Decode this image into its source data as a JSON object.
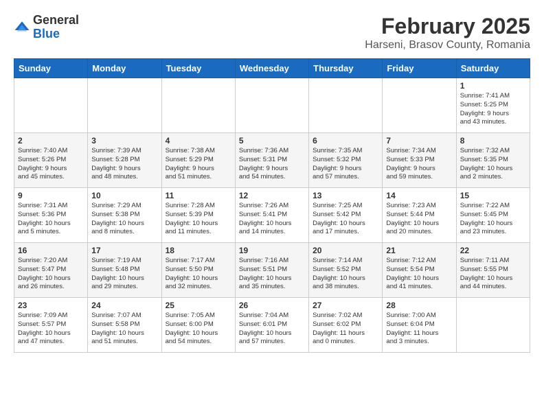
{
  "logo": {
    "general": "General",
    "blue": "Blue"
  },
  "title": "February 2025",
  "location": "Harseni, Brasov County, Romania",
  "weekdays": [
    "Sunday",
    "Monday",
    "Tuesday",
    "Wednesday",
    "Thursday",
    "Friday",
    "Saturday"
  ],
  "weeks": [
    [
      {
        "day": "",
        "info": ""
      },
      {
        "day": "",
        "info": ""
      },
      {
        "day": "",
        "info": ""
      },
      {
        "day": "",
        "info": ""
      },
      {
        "day": "",
        "info": ""
      },
      {
        "day": "",
        "info": ""
      },
      {
        "day": "1",
        "info": "Sunrise: 7:41 AM\nSunset: 5:25 PM\nDaylight: 9 hours\nand 43 minutes."
      }
    ],
    [
      {
        "day": "2",
        "info": "Sunrise: 7:40 AM\nSunset: 5:26 PM\nDaylight: 9 hours\nand 45 minutes."
      },
      {
        "day": "3",
        "info": "Sunrise: 7:39 AM\nSunset: 5:28 PM\nDaylight: 9 hours\nand 48 minutes."
      },
      {
        "day": "4",
        "info": "Sunrise: 7:38 AM\nSunset: 5:29 PM\nDaylight: 9 hours\nand 51 minutes."
      },
      {
        "day": "5",
        "info": "Sunrise: 7:36 AM\nSunset: 5:31 PM\nDaylight: 9 hours\nand 54 minutes."
      },
      {
        "day": "6",
        "info": "Sunrise: 7:35 AM\nSunset: 5:32 PM\nDaylight: 9 hours\nand 57 minutes."
      },
      {
        "day": "7",
        "info": "Sunrise: 7:34 AM\nSunset: 5:33 PM\nDaylight: 9 hours\nand 59 minutes."
      },
      {
        "day": "8",
        "info": "Sunrise: 7:32 AM\nSunset: 5:35 PM\nDaylight: 10 hours\nand 2 minutes."
      }
    ],
    [
      {
        "day": "9",
        "info": "Sunrise: 7:31 AM\nSunset: 5:36 PM\nDaylight: 10 hours\nand 5 minutes."
      },
      {
        "day": "10",
        "info": "Sunrise: 7:29 AM\nSunset: 5:38 PM\nDaylight: 10 hours\nand 8 minutes."
      },
      {
        "day": "11",
        "info": "Sunrise: 7:28 AM\nSunset: 5:39 PM\nDaylight: 10 hours\nand 11 minutes."
      },
      {
        "day": "12",
        "info": "Sunrise: 7:26 AM\nSunset: 5:41 PM\nDaylight: 10 hours\nand 14 minutes."
      },
      {
        "day": "13",
        "info": "Sunrise: 7:25 AM\nSunset: 5:42 PM\nDaylight: 10 hours\nand 17 minutes."
      },
      {
        "day": "14",
        "info": "Sunrise: 7:23 AM\nSunset: 5:44 PM\nDaylight: 10 hours\nand 20 minutes."
      },
      {
        "day": "15",
        "info": "Sunrise: 7:22 AM\nSunset: 5:45 PM\nDaylight: 10 hours\nand 23 minutes."
      }
    ],
    [
      {
        "day": "16",
        "info": "Sunrise: 7:20 AM\nSunset: 5:47 PM\nDaylight: 10 hours\nand 26 minutes."
      },
      {
        "day": "17",
        "info": "Sunrise: 7:19 AM\nSunset: 5:48 PM\nDaylight: 10 hours\nand 29 minutes."
      },
      {
        "day": "18",
        "info": "Sunrise: 7:17 AM\nSunset: 5:50 PM\nDaylight: 10 hours\nand 32 minutes."
      },
      {
        "day": "19",
        "info": "Sunrise: 7:16 AM\nSunset: 5:51 PM\nDaylight: 10 hours\nand 35 minutes."
      },
      {
        "day": "20",
        "info": "Sunrise: 7:14 AM\nSunset: 5:52 PM\nDaylight: 10 hours\nand 38 minutes."
      },
      {
        "day": "21",
        "info": "Sunrise: 7:12 AM\nSunset: 5:54 PM\nDaylight: 10 hours\nand 41 minutes."
      },
      {
        "day": "22",
        "info": "Sunrise: 7:11 AM\nSunset: 5:55 PM\nDaylight: 10 hours\nand 44 minutes."
      }
    ],
    [
      {
        "day": "23",
        "info": "Sunrise: 7:09 AM\nSunset: 5:57 PM\nDaylight: 10 hours\nand 47 minutes."
      },
      {
        "day": "24",
        "info": "Sunrise: 7:07 AM\nSunset: 5:58 PM\nDaylight: 10 hours\nand 51 minutes."
      },
      {
        "day": "25",
        "info": "Sunrise: 7:05 AM\nSunset: 6:00 PM\nDaylight: 10 hours\nand 54 minutes."
      },
      {
        "day": "26",
        "info": "Sunrise: 7:04 AM\nSunset: 6:01 PM\nDaylight: 10 hours\nand 57 minutes."
      },
      {
        "day": "27",
        "info": "Sunrise: 7:02 AM\nSunset: 6:02 PM\nDaylight: 11 hours\nand 0 minutes."
      },
      {
        "day": "28",
        "info": "Sunrise: 7:00 AM\nSunset: 6:04 PM\nDaylight: 11 hours\nand 3 minutes."
      },
      {
        "day": "",
        "info": ""
      }
    ]
  ]
}
